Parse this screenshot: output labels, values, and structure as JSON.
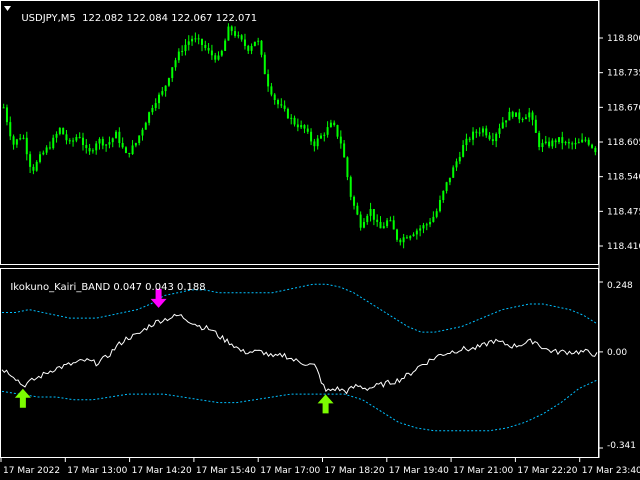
{
  "window": {
    "symbol_label": "USDJPY,M5",
    "ohlc_label": "122.082 122.084 122.067 122.071",
    "indicator_label": "Ikokuno_Kairi_BAND 0.047 0.043 0.188"
  },
  "colors": {
    "background": "#000000",
    "frame": "#ffffff",
    "candle": "#00ff00",
    "band": "#00bfff",
    "kairi_line": "#ffffff",
    "sell_arrow": "#ff00ff",
    "buy_arrow": "#7cfc00"
  },
  "icons": {
    "menu": "triangle-down-icon",
    "sell_signal": "arrow-down-icon",
    "buy_signal": "arrow-up-icon"
  },
  "chart_data": [
    {
      "type": "candlestick",
      "name": "price-chart",
      "ylim": [
        118.38,
        118.86
      ],
      "yticks": [
        "118.800",
        "118.735",
        "118.670",
        "118.605",
        "118.540",
        "118.475",
        "118.410"
      ],
      "ytick_values": [
        118.8,
        118.735,
        118.67,
        118.605,
        118.54,
        118.475,
        118.41
      ],
      "xticks": [
        "17 Mar 2022",
        "17 Mar 13:00",
        "17 Mar 14:20",
        "17 Mar 15:40",
        "17 Mar 17:00",
        "17 Mar 18:20",
        "17 Mar 19:40",
        "17 Mar 21:00",
        "17 Mar 22:20",
        "17 Mar 23:40"
      ],
      "close_path": [
        118.67,
        118.6,
        118.62,
        118.55,
        118.58,
        118.6,
        118.63,
        118.6,
        118.62,
        118.58,
        118.61,
        118.6,
        118.62,
        118.58,
        118.6,
        118.64,
        118.68,
        118.7,
        118.75,
        118.78,
        118.8,
        118.79,
        118.77,
        118.76,
        118.82,
        118.8,
        118.78,
        118.8,
        118.72,
        118.68,
        118.66,
        118.64,
        118.63,
        118.6,
        118.62,
        118.64,
        118.6,
        118.5,
        118.45,
        118.48,
        118.44,
        118.46,
        118.42,
        118.43,
        118.44,
        118.45,
        118.47,
        118.52,
        118.56,
        118.6,
        118.62,
        118.63,
        118.61,
        118.64,
        118.66,
        118.65,
        118.66,
        118.6,
        118.6,
        118.61,
        118.6,
        118.6,
        118.61,
        118.59
      ]
    },
    {
      "type": "line",
      "name": "kairi-band-indicator",
      "ylim": [
        -0.341,
        0.248
      ],
      "yticks": [
        "0.248",
        "0.00",
        "-0.341"
      ],
      "ytick_values": [
        0.248,
        0.0,
        -0.341
      ],
      "kairi": [
        -0.06,
        -0.08,
        -0.12,
        -0.1,
        -0.08,
        -0.06,
        -0.05,
        -0.04,
        -0.03,
        -0.04,
        -0.02,
        0.02,
        0.05,
        0.06,
        0.09,
        0.11,
        0.12,
        0.13,
        0.11,
        0.09,
        0.08,
        0.05,
        0.03,
        0.0,
        0.0,
        0.0,
        -0.02,
        -0.01,
        -0.03,
        -0.04,
        -0.05,
        -0.14,
        -0.13,
        -0.14,
        -0.12,
        -0.13,
        -0.12,
        -0.11,
        -0.1,
        -0.08,
        -0.05,
        -0.03,
        -0.01,
        0.0,
        0.01,
        0.01,
        0.02,
        0.04,
        0.03,
        0.02,
        0.03,
        0.04,
        0.01,
        0.0,
        0.0,
        0.0,
        0.0,
        -0.01
      ],
      "upper_band": [
        0.14,
        0.14,
        0.15,
        0.14,
        0.13,
        0.12,
        0.12,
        0.12,
        0.13,
        0.14,
        0.15,
        0.17,
        0.2,
        0.21,
        0.22,
        0.22,
        0.21,
        0.21,
        0.21,
        0.21,
        0.21,
        0.22,
        0.23,
        0.24,
        0.24,
        0.23,
        0.21,
        0.18,
        0.15,
        0.12,
        0.09,
        0.07,
        0.07,
        0.08,
        0.09,
        0.11,
        0.13,
        0.15,
        0.16,
        0.17,
        0.17,
        0.16,
        0.15,
        0.13,
        0.1
      ],
      "lower_band": [
        -0.14,
        -0.15,
        -0.16,
        -0.16,
        -0.17,
        -0.17,
        -0.16,
        -0.15,
        -0.15,
        -0.15,
        -0.16,
        -0.17,
        -0.18,
        -0.18,
        -0.17,
        -0.16,
        -0.15,
        -0.15,
        -0.15,
        -0.15,
        -0.17,
        -0.21,
        -0.25,
        -0.27,
        -0.28,
        -0.28,
        -0.28,
        -0.28,
        -0.27,
        -0.25,
        -0.22,
        -0.18,
        -0.13,
        -0.1
      ],
      "signals": [
        {
          "kind": "buy",
          "index": 2
        },
        {
          "kind": "sell",
          "index": 15
        },
        {
          "kind": "buy",
          "index": 31
        }
      ]
    }
  ]
}
